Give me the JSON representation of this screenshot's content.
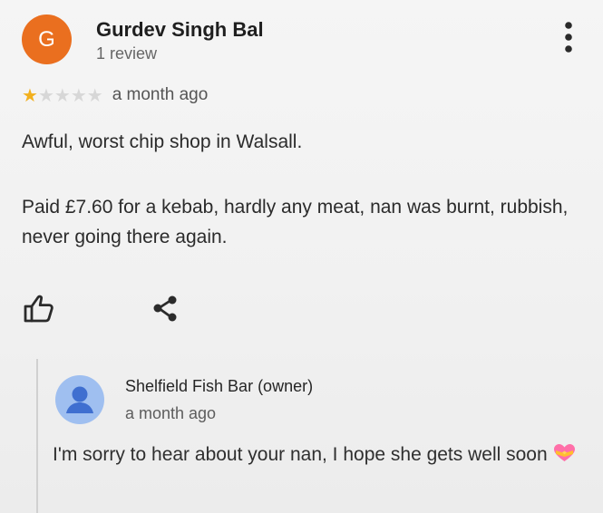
{
  "review": {
    "avatar_initial": "G",
    "reviewer_name": "Gurdev Singh Bal",
    "reviewer_count": "1 review",
    "rating": 1,
    "rating_max": 5,
    "time": "a month ago",
    "body_line1": "Awful, worst chip shop in Walsall.",
    "body_line2": "Paid £7.60 for a kebab, hardly any meat, nan was burnt, rubbish, never going there again."
  },
  "actions": {
    "like_icon": "thumbs-up-icon",
    "share_icon": "share-icon"
  },
  "reply": {
    "owner_name": "Shelfield Fish Bar (owner)",
    "owner_time": "a month ago",
    "text": "I'm sorry to hear about your nan, I hope she gets well soon"
  },
  "colors": {
    "avatar": "#ea6f1f",
    "star_filled": "#f2b01e",
    "star_empty": "#d7d7d7",
    "owner_avatar": "#9fbff0"
  }
}
